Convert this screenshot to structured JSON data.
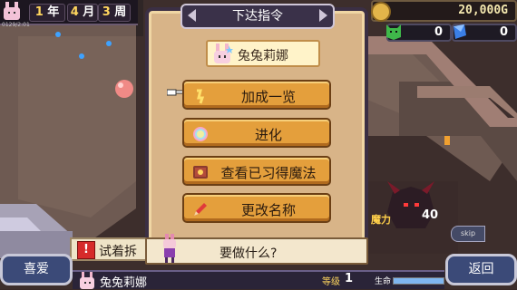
{
  "header": {
    "year_value": "1",
    "year_unit": "年",
    "month_value": "4",
    "month_unit": "月",
    "week_value": "3",
    "week_unit": "周",
    "sub_id": "0129/2:01"
  },
  "resources": {
    "gold": "20,000G",
    "green_count": "0",
    "blue_count": "0"
  },
  "menu": {
    "title": "下达指令",
    "character_name": "兔兔莉娜",
    "items": [
      {
        "label": "加成一览",
        "icon": "chain-icon"
      },
      {
        "label": "进化",
        "icon": "rainbow-icon"
      },
      {
        "label": "查看已习得魔法",
        "icon": "spellbook-icon"
      },
      {
        "label": "更改名称",
        "icon": "pencil-icon"
      }
    ],
    "prompt": "要做什么?"
  },
  "bottom": {
    "try_text": "试着拆",
    "favorite_label": "喜爱",
    "back_label": "返回",
    "skip_label": "skip",
    "status_name": "兔兔莉娜",
    "level_label": "等级",
    "level_value": "1",
    "hp_label": "生命",
    "hp_fraction": 1.0
  },
  "monster": {
    "magic_tag": "魔力",
    "level_value": "40"
  },
  "colors": {
    "panel_bg": "#d8b488",
    "button_bg": "#e49f3c",
    "title_bg": "#3a3149",
    "gold_text": "#f5e9b0"
  }
}
